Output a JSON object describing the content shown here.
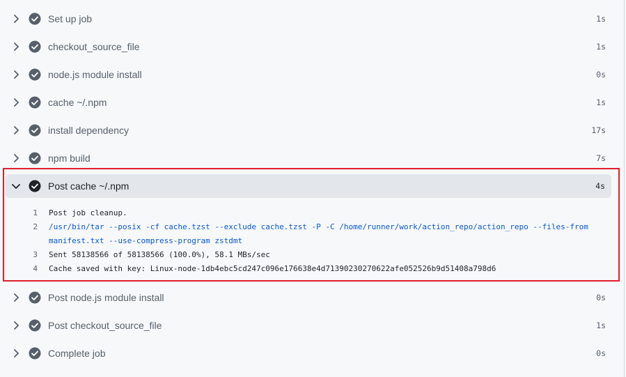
{
  "steps_before": [
    {
      "label": "Set up job",
      "duration": "1s"
    },
    {
      "label": "checkout_source_file",
      "duration": "1s"
    },
    {
      "label": "node.js module install",
      "duration": "0s"
    },
    {
      "label": "cache ~/.npm",
      "duration": "1s"
    },
    {
      "label": "install dependency",
      "duration": "17s"
    },
    {
      "label": "npm build",
      "duration": "7s"
    }
  ],
  "expanded_step": {
    "label": "Post cache ~/.npm",
    "duration": "4s",
    "log": [
      {
        "n": "1",
        "text": "Post job cleanup.",
        "command": false
      },
      {
        "n": "2",
        "text": "/usr/bin/tar --posix -cf cache.tzst --exclude cache.tzst -P -C /home/runner/work/action_repo/action_repo --files-from manifest.txt --use-compress-program zstdmt",
        "command": true
      },
      {
        "n": "3",
        "text": "Sent 58138566 of 58138566 (100.0%), 58.1 MBs/sec",
        "command": false
      },
      {
        "n": "4",
        "text": "Cache saved with key: Linux-node-1db4ebc5cd247c096e176638e4d71390230270622afe052526b9d51408a798d6",
        "command": false
      }
    ]
  },
  "steps_after": [
    {
      "label": "Post node.js module install",
      "duration": "0s"
    },
    {
      "label": "Post checkout_source_file",
      "duration": "1s"
    },
    {
      "label": "Complete job",
      "duration": "0s"
    }
  ],
  "colors": {
    "check_fill": "#57606a",
    "highlight_border": "#e01e2a",
    "command_text": "#0a58ca"
  },
  "icons": {
    "collapsed": "chevron-right-icon",
    "expanded": "chevron-down-icon",
    "status": "check-circle-icon"
  }
}
